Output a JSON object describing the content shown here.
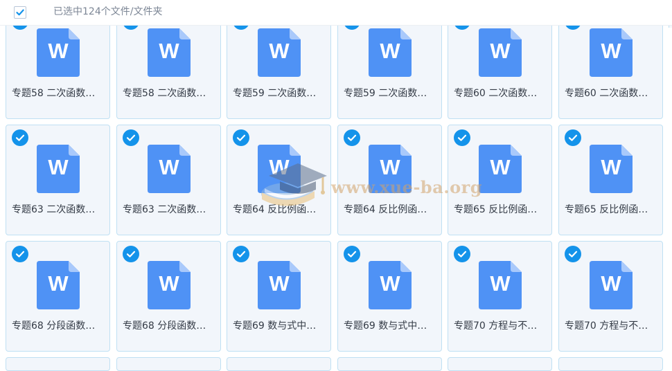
{
  "header": {
    "selected_text": "已选中124个文件/文件夹"
  },
  "watermark": {
    "text": "www.xue-ba.org"
  },
  "file_icon": {
    "letter": "W"
  },
  "colors": {
    "accent": "#1493ea",
    "file_icon": "#4f92f5",
    "card_bg": "#f2f6fb",
    "card_border": "#bfe0f3"
  },
  "rows": [
    {
      "items": [
        {
          "name": "专题58 二次函数…",
          "selected": true
        },
        {
          "name": "专题58 二次函数…",
          "selected": true
        },
        {
          "name": "专题59 二次函数…",
          "selected": true
        },
        {
          "name": "专题59 二次函数…",
          "selected": true
        },
        {
          "name": "专题60 二次函数…",
          "selected": true
        },
        {
          "name": "专题60 二次函数…",
          "selected": true
        }
      ]
    },
    {
      "items": [
        {
          "name": "专题63 二次函数…",
          "selected": true
        },
        {
          "name": "专题63 二次函数…",
          "selected": true
        },
        {
          "name": "专题64 反比例函…",
          "selected": true
        },
        {
          "name": "专题64 反比例函…",
          "selected": true
        },
        {
          "name": "专题65 反比例函…",
          "selected": true
        },
        {
          "name": "专题65 反比例函…",
          "selected": true
        }
      ]
    },
    {
      "items": [
        {
          "name": "专题68 分段函数…",
          "selected": true
        },
        {
          "name": "专题68 分段函数…",
          "selected": true
        },
        {
          "name": "专题69 数与式中…",
          "selected": true
        },
        {
          "name": "专题69 数与式中…",
          "selected": true
        },
        {
          "name": "专题70 方程与不…",
          "selected": true
        },
        {
          "name": "专题70 方程与不…",
          "selected": true
        }
      ]
    }
  ]
}
